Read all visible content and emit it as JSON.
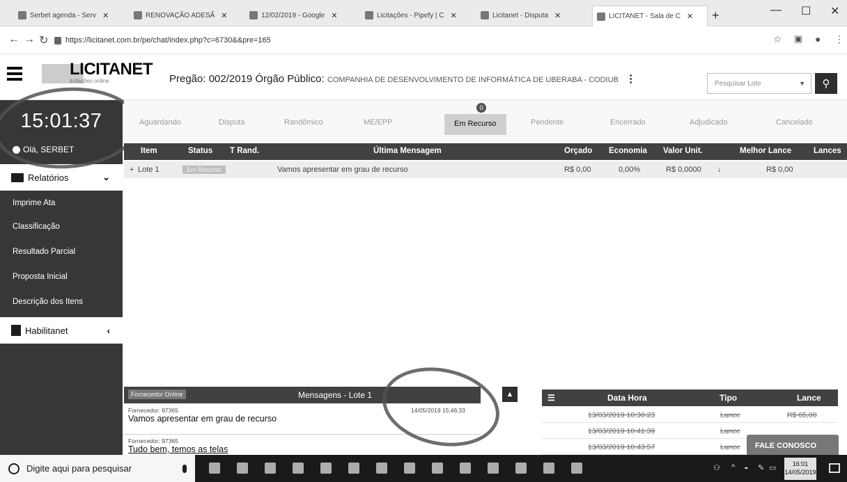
{
  "browser": {
    "tabs": [
      {
        "label": "Serbet agenda - Serv"
      },
      {
        "label": "RENOVAÇÃO ADESÃ"
      },
      {
        "label": "12/02/2019 - Google"
      },
      {
        "label": "Licitações - Pipefy | C"
      },
      {
        "label": "Licitanet - Disputa"
      },
      {
        "label": "LICITANET - Sala de C"
      }
    ],
    "url": "https://licitanet.com.br/pe/chat/index.php?c=6730&&pre=165"
  },
  "header": {
    "brand": "LICITANET",
    "brand_sub": "licitações online",
    "pregao_label": "Pregão: 002/2019 Órgão Público:",
    "orgao": "COMPANHIA DE DESENVOLVIMENTO DE INFORMÁTICA DE UBERABA - CODIUB",
    "search_placeholder": "Pesquisar Lote"
  },
  "sidebar": {
    "clock": "15:01:37",
    "greeting": "Olá, SERBET",
    "relatorios": "Relatórios",
    "links": [
      "Imprime Ata",
      "Classificação",
      "Resultado Parcial",
      "Proposta Inicial",
      "Descrição dos Itens"
    ],
    "habilitanet": "Habilitanet"
  },
  "status_tabs": {
    "tabs": [
      "Aguardando",
      "Disputa",
      "Randômico",
      "ME/EPP",
      "Em Recurso",
      "Pendente",
      "Encerrado",
      "Adjudicado",
      "Cancelado"
    ],
    "active_badge": "0"
  },
  "grid": {
    "headers": [
      "Item",
      "Status",
      "T Rand.",
      "Última Mensagem",
      "Orçado",
      "Economia",
      "Valor Unit.",
      "Melhor Lance",
      "Lances"
    ],
    "row": {
      "item": "Lote 1",
      "status": "Em Recurso",
      "message": "Vamos apresentar em grau de recurso",
      "orcado": "R$ 0,00",
      "economia": "0,00%",
      "valor_unit": "R$ 0,0000",
      "melhor_lance": "R$ 0,00"
    }
  },
  "messages": {
    "online_label": "Fornecedor Online",
    "title": "Mensagens - Lote 1",
    "items": [
      {
        "from": "Fornecedor: 97365",
        "text": "Vamos apresentar em grau de recurso",
        "time": "14/05/2019 15:46:33"
      },
      {
        "from": "Fornecedor: 97365",
        "text": "Tudo bem, temos as telas"
      }
    ]
  },
  "bids": {
    "headers": [
      "Data Hora",
      "Tipo",
      "Lance"
    ],
    "rows": [
      {
        "datetime": "13/03/2019 10:30:23",
        "tipo": "Lance",
        "lance": "R$ 65,00"
      },
      {
        "datetime": "13/03/2019 10:41:39",
        "tipo": "Lance",
        "lance": ""
      },
      {
        "datetime": "13/03/2019 10:43:57",
        "tipo": "Lance",
        "lance": ""
      }
    ],
    "fale_label": "FALE CONOSCO"
  },
  "taskbar": {
    "search": "Digite aqui para pesquisar",
    "time": "16:01",
    "date": "14/05/2019"
  }
}
